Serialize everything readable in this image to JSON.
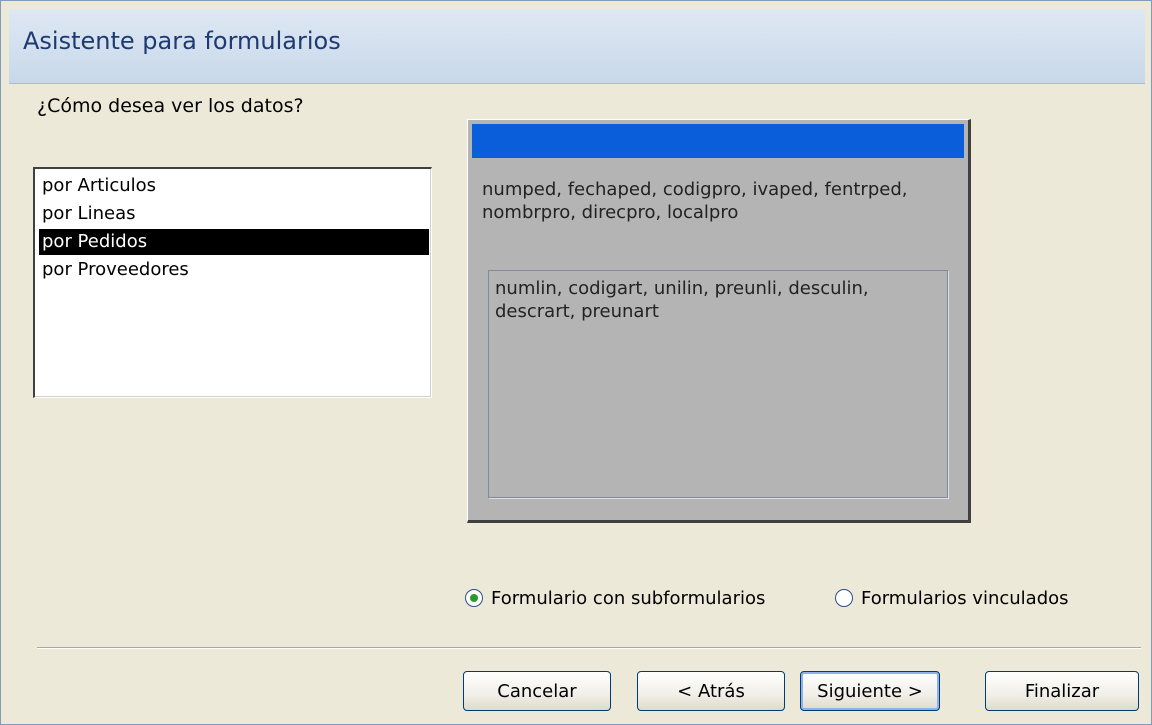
{
  "window": {
    "title": "Asistente para formularios"
  },
  "question": "¿Cómo desea ver los datos?",
  "views": [
    {
      "label": "por Articulos",
      "selected": false
    },
    {
      "label": "por Lineas",
      "selected": false
    },
    {
      "label": "por Pedidos",
      "selected": true
    },
    {
      "label": "por Proveedores",
      "selected": false
    }
  ],
  "preview": {
    "main_fields": "numped, fechaped, codigpro, ivaped, fentrped, nombrpro, direcpro, localpro",
    "subform_fields": "numlin, codigart, unilin, preunli, desculin, descrart, preunart"
  },
  "options": {
    "subforms_label": "Formulario con subformularios",
    "subforms_checked": true,
    "linked_label": "Formularios vinculados",
    "linked_checked": false
  },
  "buttons": {
    "cancel": "Cancelar",
    "back": "< Atrás",
    "next": "Siguiente >",
    "finish": "Finalizar"
  },
  "colors": {
    "preview_header": "#0a5ed9",
    "selection": "#000000",
    "radio_dot": "#2a9a2a"
  }
}
